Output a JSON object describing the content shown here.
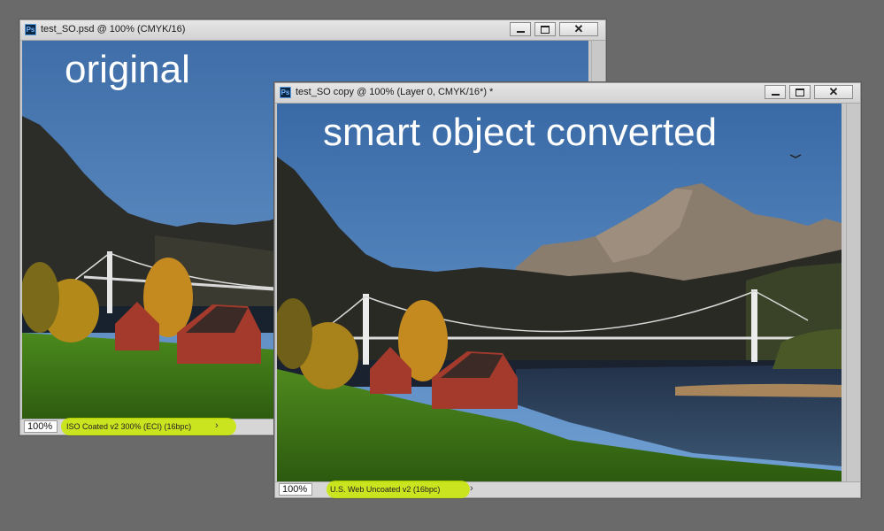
{
  "window_original": {
    "title": "test_SO.psd @ 100% (CMYK/16)",
    "overlay_label": "original",
    "zoom": "100%",
    "color_profile": "ISO Coated v2 300% (ECI) (16bpc)",
    "arrow": "›",
    "minimize_icon": "minimize-icon",
    "maximize_icon": "maximize-icon",
    "close_glyph": "✕"
  },
  "window_converted": {
    "title": "test_SO copy @ 100% (Layer 0, CMYK/16*) *",
    "overlay_label": "smart object converted",
    "zoom": "100%",
    "color_profile": "U.S. Web Uncoated v2 (16bpc)",
    "arrow": "›",
    "minimize_icon": "minimize-icon",
    "maximize_icon": "maximize-icon",
    "close_glyph": "✕"
  },
  "app_icon_text": "Ps",
  "colors": {
    "workspace": "#6a6a6a",
    "highlight": "#c9e600",
    "sky": "#4a76ad",
    "grass": "#4f8a1e",
    "barn": "#a33a2c"
  }
}
